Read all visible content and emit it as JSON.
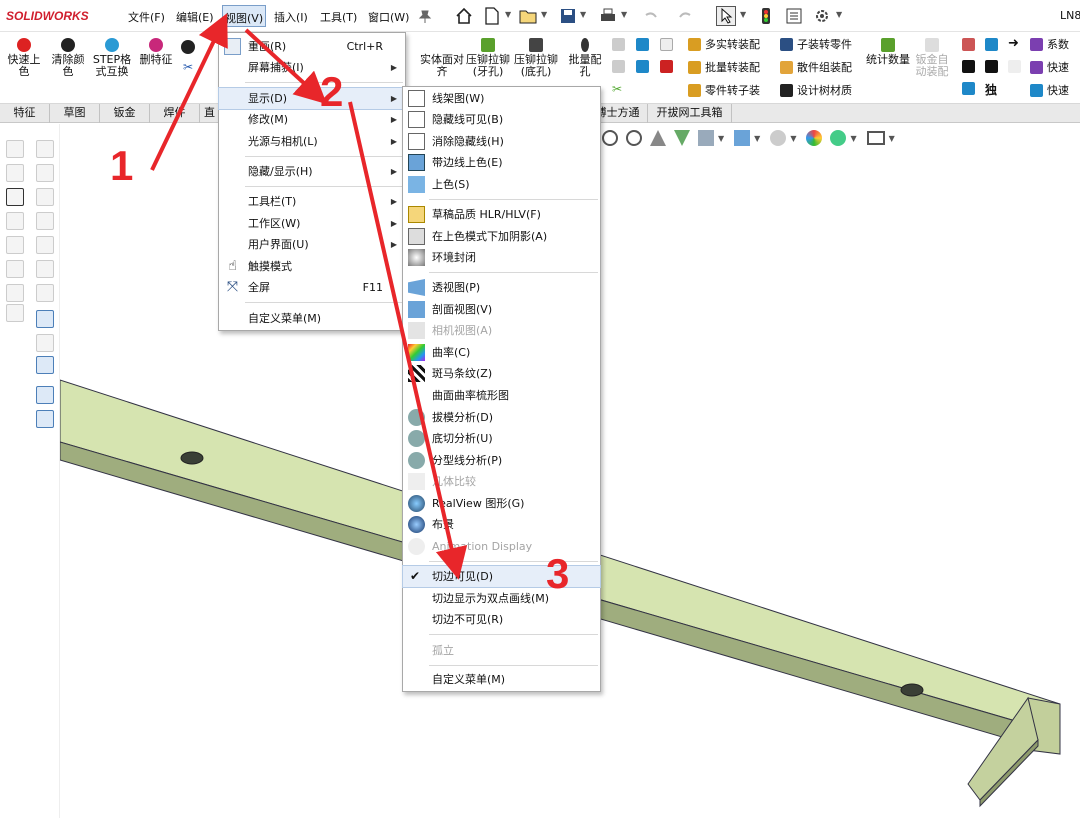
{
  "menubar": {
    "logo": "SOLIDWORKS",
    "items": [
      "文件(F)",
      "编辑(E)",
      "视图(V)",
      "插入(I)",
      "工具(T)",
      "窗口(W)"
    ],
    "right_text": "LN8"
  },
  "ribbon": {
    "big_buttons": [
      "快速上色",
      "清除颜色",
      "STEP格式互换",
      "删特征",
      "实体面对齐",
      "压铆拉铆(牙孔)",
      "压铆拉铆(底孔)",
      "批量配孔"
    ],
    "tool_list": [
      "多实转装配",
      "子装转零件",
      "批量转装配",
      "散件组装配",
      "零件转子装",
      "设计树材质"
    ],
    "stat": "统计数量",
    "disabled_btn": "钣金自动装配",
    "right_list": [
      "系数",
      "快速",
      "快速"
    ],
    "right_glyph": "独"
  },
  "tabs": [
    "特征",
    "草图",
    "钣金",
    "焊件",
    "直",
    "博士方通",
    "开拔网工具箱"
  ],
  "view_menu": [
    {
      "label": "重画(R)",
      "shortcut": "Ctrl+R"
    },
    {
      "label": "屏幕捕获(I)"
    },
    {
      "label": "显示(D)"
    },
    {
      "label": "修改(M)"
    },
    {
      "label": "光源与相机(L)"
    },
    {
      "label": "隐藏/显示(H)"
    },
    {
      "label": "工具栏(T)"
    },
    {
      "label": "工作区(W)"
    },
    {
      "label": "用户界面(U)"
    },
    {
      "label": "触摸模式"
    },
    {
      "label": "全屏",
      "shortcut": "F11"
    },
    {
      "label": "自定义菜单(M)"
    }
  ],
  "display_menu": [
    "线架图(W)",
    "隐藏线可见(B)",
    "消除隐藏线(H)",
    "带边线上色(E)",
    "上色(S)",
    "草稿品质 HLR/HLV(F)",
    "在上色模式下加阴影(A)",
    "环境封闭",
    "透视图(P)",
    "剖面视图(V)",
    "相机视图(A)",
    "曲率(C)",
    "斑马条纹(Z)",
    "曲面曲率梳形图",
    "拔模分析(D)",
    "底切分析(U)",
    "分型线分析(P)",
    "几体比较",
    "RealView 图形(G)",
    "布景",
    "Animation Display",
    "切边可见(D)",
    "切边显示为双点画线(M)",
    "切边不可见(R)",
    "孤立",
    "自定义菜单(M)"
  ],
  "annotations": [
    "1",
    "2",
    "3"
  ],
  "colors": {
    "accent": "#e8262a",
    "part": "#d6e4b0",
    "part_dark": "#8e9b6c"
  }
}
